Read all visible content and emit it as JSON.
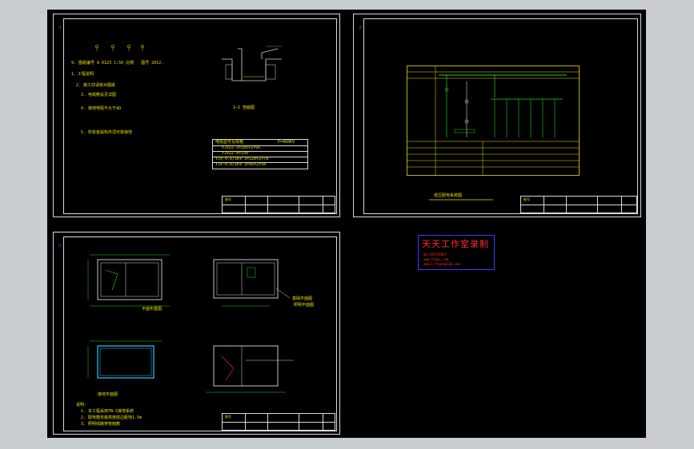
{
  "drawing": {
    "sheet1": {
      "note_heading": "1、工程说明",
      "notes": [
        "2. 施工前请核对图纸",
        "3. 电缆敷设见详图",
        "4. 接地电阻不大于4Ω",
        "5. 所有金属构件须可靠接地"
      ],
      "section_label": "1—1 剖面图",
      "table_title": "电缆型号及规格",
      "table_value": "P=460KV",
      "table_rows": [
        "YJV22-3×185+2×95",
        "YJV22-4×150",
        "YJV-0.6/1KV 3×120+2×70",
        "YJV-0.6/1KV 3×95+2×50"
      ],
      "title_block": "图号"
    },
    "sheet2": {
      "caption": "低压配电系统图",
      "title_block": "图号"
    },
    "sheet3": {
      "plan1_label": "平面布置图",
      "plan2_label": "基础平面图",
      "plan3_label": "接地平面图",
      "plan4_label": "照明平面图",
      "notes": [
        "说明：",
        "1. 本工程采用TN-S接地系统",
        "2. 配电箱安装高度底边距地1.5m",
        "3. 照明线路穿管暗敷"
      ],
      "title_block": "图号"
    }
  },
  "stamp": {
    "title": "天天工作室录制",
    "line1": "QQ:455255887",
    "line2": "www.ttgzs.com",
    "line3": "email:ttgzs@126.com"
  }
}
